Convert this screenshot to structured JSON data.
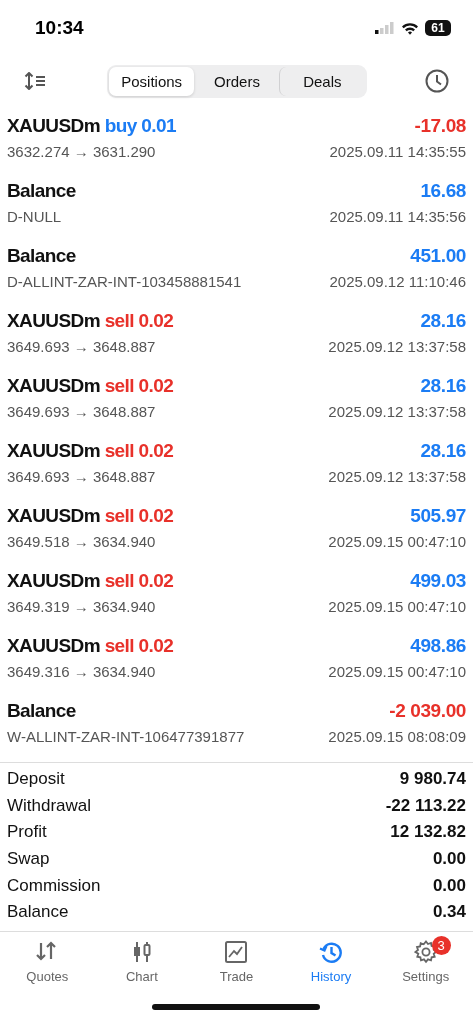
{
  "status_bar": {
    "time": "10:34",
    "battery": "61"
  },
  "segments": [
    {
      "label": "Positions",
      "selected": true
    },
    {
      "label": "Orders",
      "selected": false
    },
    {
      "label": "Deals",
      "selected": false
    }
  ],
  "deals": [
    {
      "kind": "buy",
      "symbol": "XAUUSDm",
      "side": "buy",
      "volume": "0.01",
      "profit": "-17.08",
      "loss": true,
      "detail": "3632.274 → 3631.290",
      "time": "2025.09.11 14:35:55"
    },
    {
      "kind": "balance",
      "symbol": "Balance",
      "profit": "16.68",
      "loss": false,
      "detail": "D-NULL",
      "time": "2025.09.11 14:35:56"
    },
    {
      "kind": "balance",
      "symbol": "Balance",
      "profit": "451.00",
      "loss": false,
      "detail": "D-ALLINT-ZAR-INT-103458881541",
      "time": "2025.09.12 11:10:46"
    },
    {
      "kind": "sell",
      "symbol": "XAUUSDm",
      "side": "sell",
      "volume": "0.02",
      "profit": "28.16",
      "loss": false,
      "detail": "3649.693 → 3648.887",
      "time": "2025.09.12 13:37:58"
    },
    {
      "kind": "sell",
      "symbol": "XAUUSDm",
      "side": "sell",
      "volume": "0.02",
      "profit": "28.16",
      "loss": false,
      "detail": "3649.693 → 3648.887",
      "time": "2025.09.12 13:37:58"
    },
    {
      "kind": "sell",
      "symbol": "XAUUSDm",
      "side": "sell",
      "volume": "0.02",
      "profit": "28.16",
      "loss": false,
      "detail": "3649.693 → 3648.887",
      "time": "2025.09.12 13:37:58"
    },
    {
      "kind": "sell",
      "symbol": "XAUUSDm",
      "side": "sell",
      "volume": "0.02",
      "profit": "505.97",
      "loss": false,
      "detail": "3649.518 → 3634.940",
      "time": "2025.09.15 00:47:10"
    },
    {
      "kind": "sell",
      "symbol": "XAUUSDm",
      "side": "sell",
      "volume": "0.02",
      "profit": "499.03",
      "loss": false,
      "detail": "3649.319 → 3634.940",
      "time": "2025.09.15 00:47:10"
    },
    {
      "kind": "sell",
      "symbol": "XAUUSDm",
      "side": "sell",
      "volume": "0.02",
      "profit": "498.86",
      "loss": false,
      "detail": "3649.316 → 3634.940",
      "time": "2025.09.15 00:47:10"
    },
    {
      "kind": "balance",
      "symbol": "Balance",
      "profit": "-2 039.00",
      "loss": true,
      "detail": "W-ALLINT-ZAR-INT-106477391877",
      "time": "2025.09.15 08:08:09"
    }
  ],
  "summary": [
    {
      "label": "Deposit",
      "value": "9 980.74"
    },
    {
      "label": "Withdrawal",
      "value": "-22 113.22"
    },
    {
      "label": "Profit",
      "value": "12 132.82"
    },
    {
      "label": "Swap",
      "value": "0.00"
    },
    {
      "label": "Commission",
      "value": "0.00"
    },
    {
      "label": "Balance",
      "value": "0.34"
    }
  ],
  "tab_bar": [
    {
      "kind": "quotes",
      "label": "Quotes",
      "selected": false
    },
    {
      "kind": "chart",
      "label": "Chart",
      "selected": false
    },
    {
      "kind": "trade",
      "label": "Trade",
      "selected": false
    },
    {
      "kind": "history",
      "label": "History",
      "selected": true
    },
    {
      "kind": "settings",
      "label": "Settings",
      "selected": false,
      "badge": "3"
    }
  ]
}
